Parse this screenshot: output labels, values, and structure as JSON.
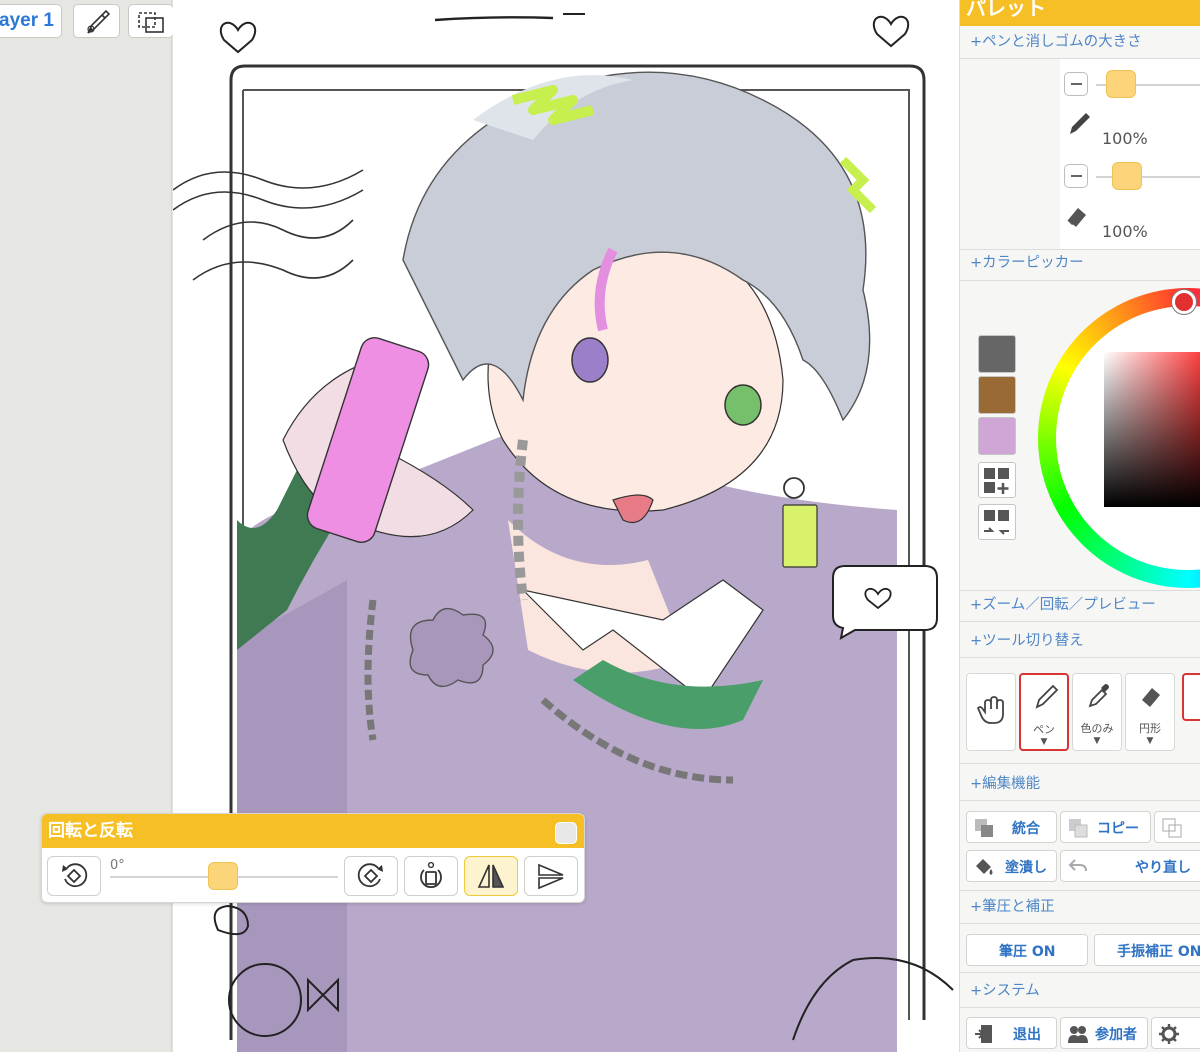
{
  "toolbar": {
    "layer_tab": "ayer 1",
    "brush_icon": "brush-settings-icon",
    "transform_icon": "transform-icon"
  },
  "rotate_dialog": {
    "title": "回転と反転",
    "angle_value": "0°",
    "angle_level": 0.5,
    "buttons": [
      "rotate-ccw-icon",
      "rotate-cw-icon",
      "reset-rotation-icon",
      "flip-horizontal-icon",
      "flip-vertical-icon"
    ]
  },
  "palette": {
    "header": "パレット",
    "sections": {
      "pen_eraser_size": "+ペンと消しゴムの大きさ",
      "color_picker": "+カラーピッカー",
      "zoom": "+ズーム／回転／プレビュー",
      "tool_switch": "+ツール切り替え",
      "edit": "+編集機能",
      "pressure": "+筆圧と補正",
      "system": "+システム"
    },
    "pen_opacity": "100%",
    "eraser_opacity": "100%",
    "colors": {
      "accent": "#f6bf25",
      "link": "#4f86c6",
      "swatch_1": "#666666",
      "swatch_2": "#9a6a35",
      "swatch_3": "#cfa6d6"
    },
    "tools": {
      "hand_icon": "hand-icon",
      "pen_label": "ペン",
      "eyedropper_label": "色のみ",
      "eraser_label": "円形",
      "caret": "▼"
    },
    "edit_buttons": {
      "merge": "統合",
      "copy": "コピー",
      "fill": "塗潰し",
      "redo": "やり直し"
    },
    "pressure_buttons": {
      "pressure_on": "筆圧 ON",
      "stabilizer_on": "手振補正 ON"
    },
    "system_buttons": {
      "exit": "退出",
      "participants": "参加者"
    }
  }
}
